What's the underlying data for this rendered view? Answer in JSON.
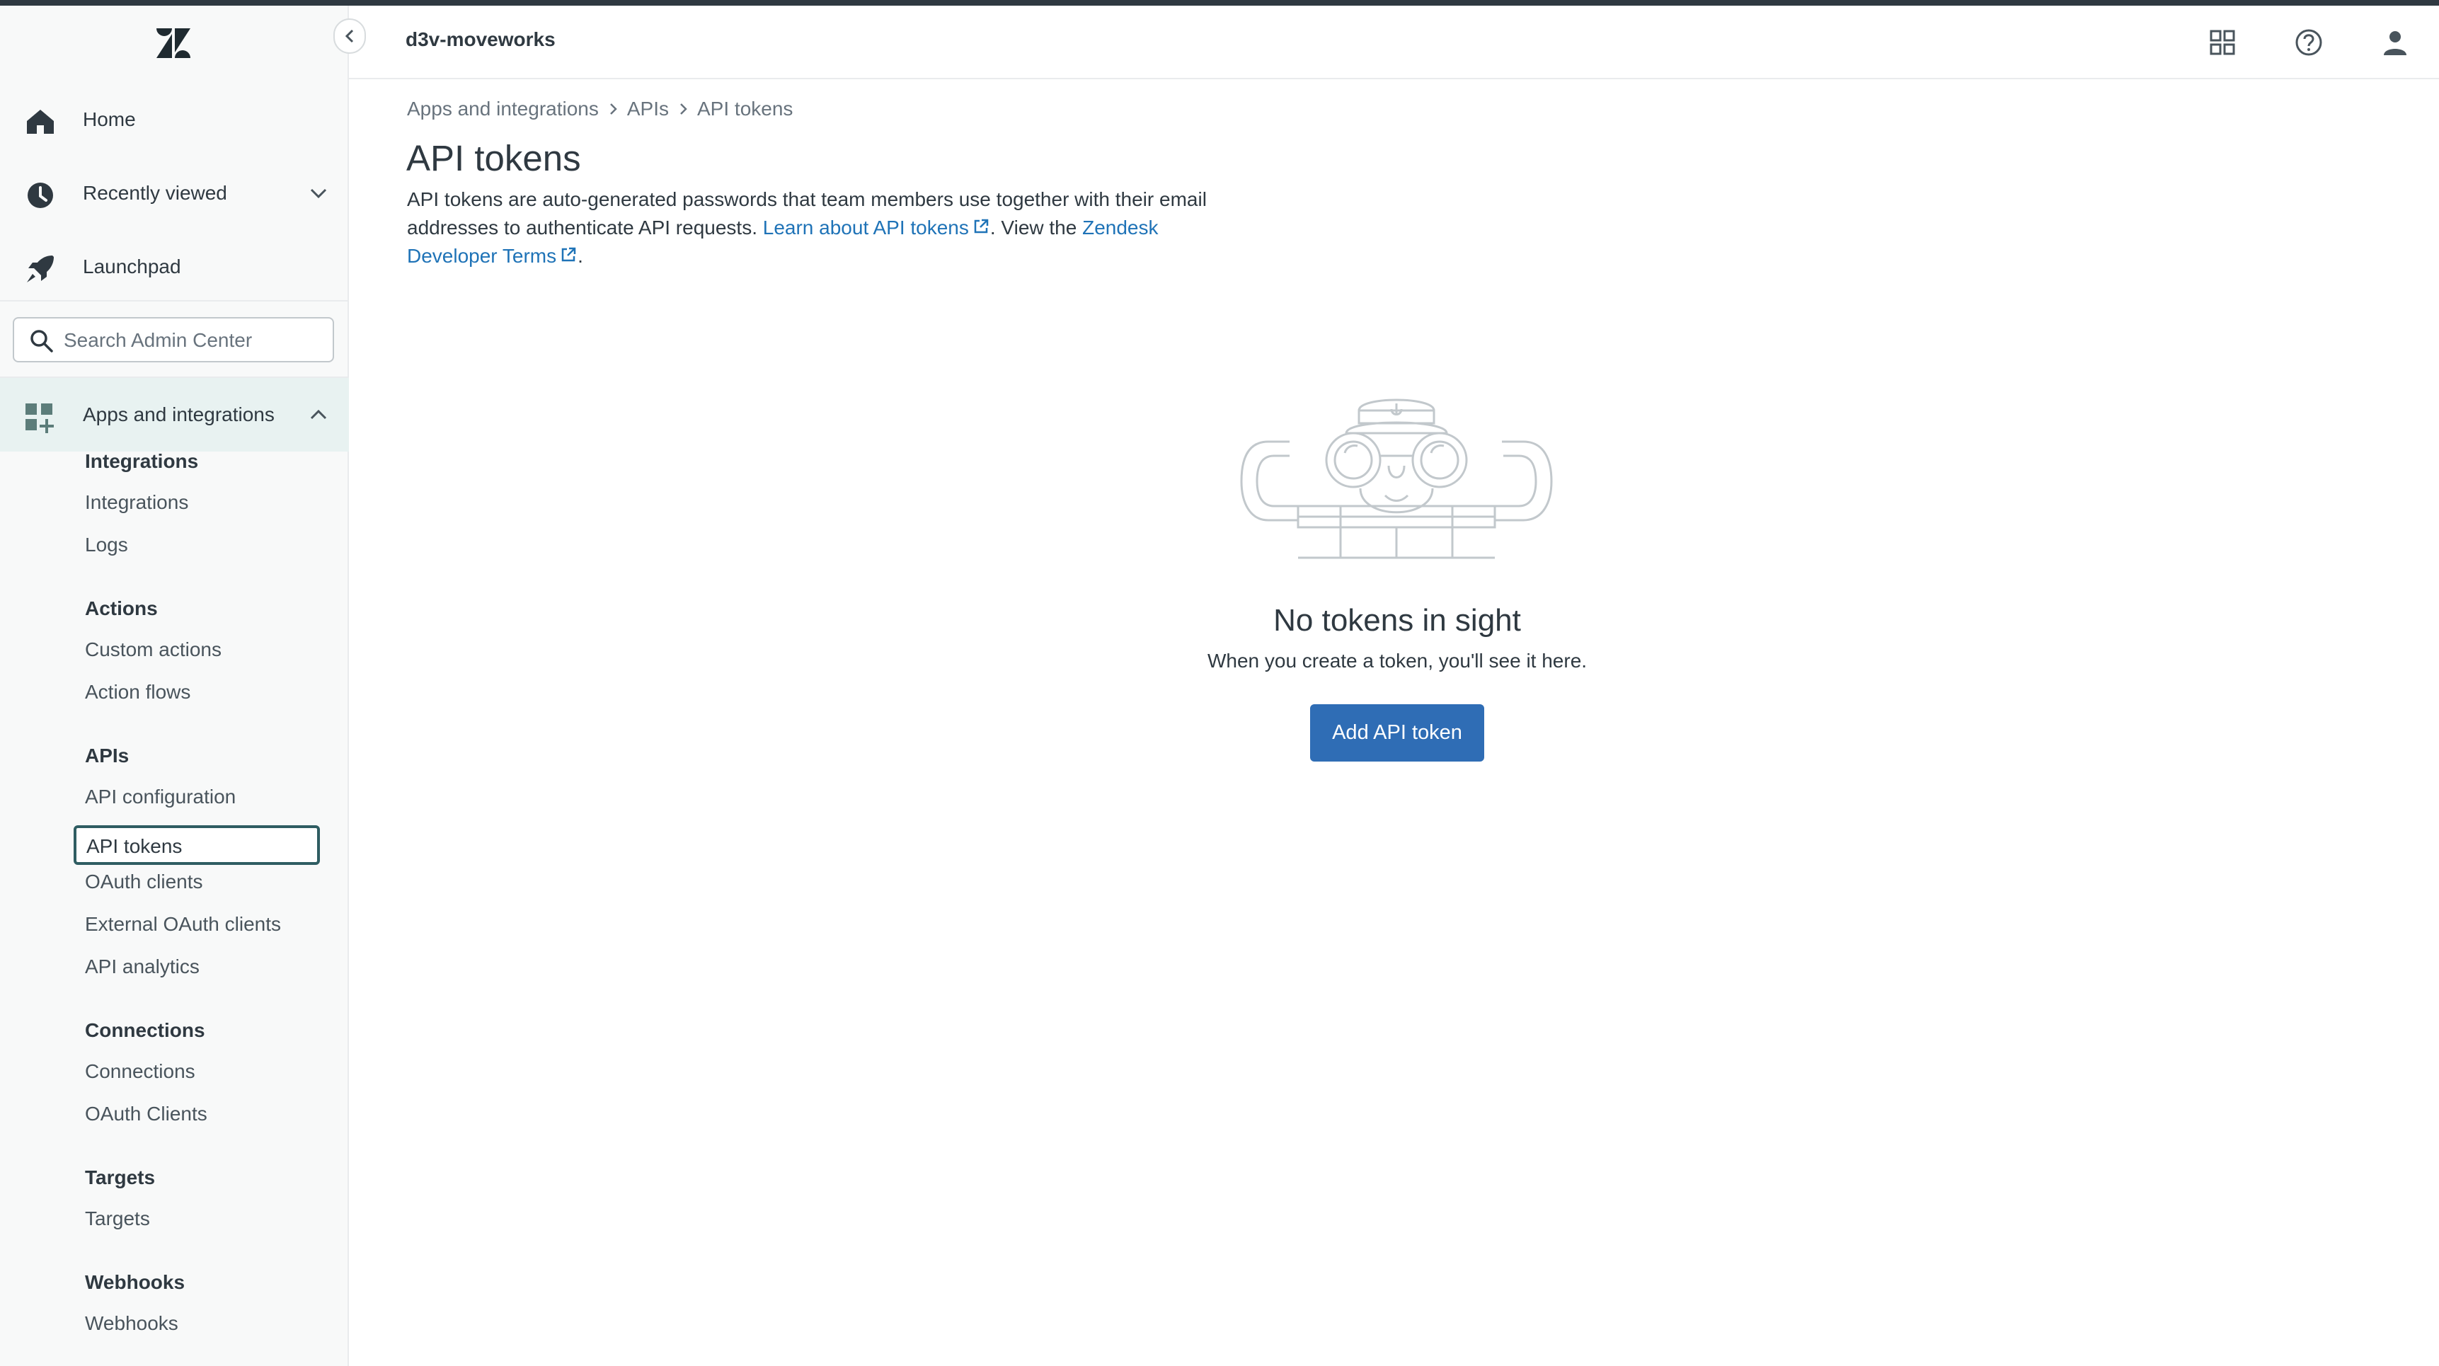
{
  "header": {
    "brand": "d3v-moveworks",
    "icons": [
      "apps-grid-icon",
      "help-icon",
      "user-icon"
    ]
  },
  "sidebar": {
    "nav": [
      {
        "label": "Home",
        "icon": "home-icon"
      },
      {
        "label": "Recently viewed",
        "icon": "clock-icon"
      },
      {
        "label": "Launchpad",
        "icon": "rocket-icon"
      }
    ],
    "search_placeholder": "Search Admin Center",
    "active_section": {
      "label": "Apps and integrations",
      "icon": "apps-add-icon"
    },
    "groups": [
      {
        "heading": "Integrations",
        "items": [
          "Integrations",
          "Logs"
        ]
      },
      {
        "heading": "Actions",
        "items": [
          "Custom actions",
          "Action flows"
        ]
      },
      {
        "heading": "APIs",
        "items": [
          "API configuration",
          "API tokens",
          "OAuth clients",
          "External OAuth clients",
          "API analytics"
        ]
      },
      {
        "heading": "Connections",
        "items": [
          "Connections",
          "OAuth Clients"
        ]
      },
      {
        "heading": "Targets",
        "items": [
          "Targets"
        ]
      },
      {
        "heading": "Webhooks",
        "items": [
          "Webhooks"
        ]
      }
    ],
    "selected_item": "API tokens"
  },
  "main": {
    "breadcrumb": [
      "Apps and integrations",
      "APIs",
      "API tokens"
    ],
    "title": "API tokens",
    "description": {
      "text1": "API tokens are auto-generated passwords that team members use together with their email addresses to authenticate API requests.",
      "link1": "Learn about API tokens",
      "text2": ". View the",
      "link2": "Zendesk Developer Terms",
      "text3": "."
    },
    "empty_state": {
      "title": "No tokens in sight",
      "subtitle": "When you create a token, you'll see it here.",
      "button": "Add API token"
    }
  },
  "colors": {
    "accent": "#1f73b7",
    "primary_button": "#2f6db5",
    "active_nav_bg": "#e8f2f1"
  }
}
